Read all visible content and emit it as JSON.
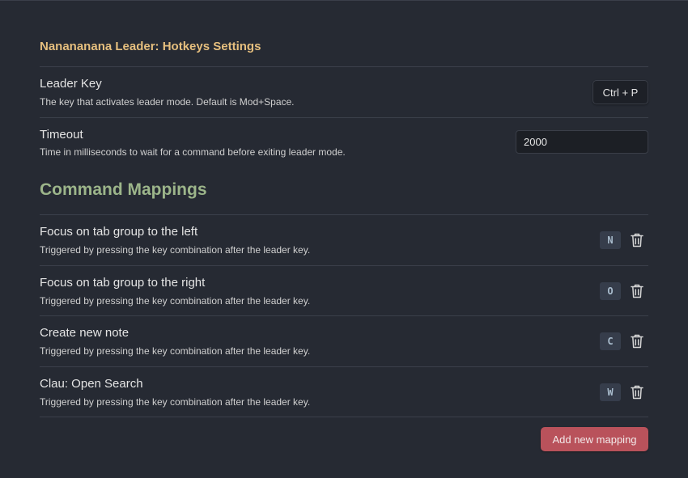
{
  "plugin_title": "Nanananana Leader: Hotkeys Settings",
  "leader_key": {
    "name": "Leader Key",
    "description": "The key that activates leader mode. Default is Mod+Space.",
    "value": "Ctrl + P"
  },
  "timeout": {
    "name": "Timeout",
    "description": "Time in milliseconds to wait for a command before exiting leader mode.",
    "value": "2000"
  },
  "section_heading": "Command Mappings",
  "mappings": [
    {
      "name": "Focus on tab group to the left",
      "description": "Triggered by pressing the key combination after the leader key.",
      "key": "N"
    },
    {
      "name": "Focus on tab group to the right",
      "description": "Triggered by pressing the key combination after the leader key.",
      "key": "O"
    },
    {
      "name": "Create new note",
      "description": "Triggered by pressing the key combination after the leader key.",
      "key": "C"
    },
    {
      "name": "Clau: Open Search",
      "description": "Triggered by pressing the key combination after the leader key.",
      "key": "W"
    }
  ],
  "add_button_label": "Add new mapping",
  "colors": {
    "background": "#262a33",
    "plugin_title": "#e6bf7e",
    "section_heading": "#9cb58a",
    "accent_button": "#b9525b",
    "key_badge_bg": "#363d4b",
    "key_badge_text": "#a9bccd"
  }
}
